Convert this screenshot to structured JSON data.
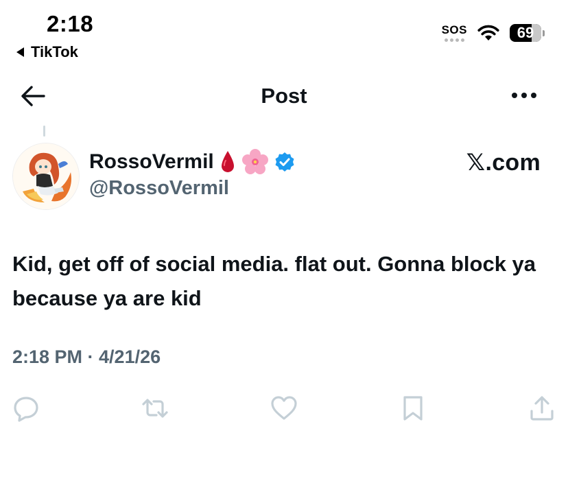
{
  "status_bar": {
    "time": "2:18",
    "back_app": "TikTok",
    "sos": "SOS",
    "battery": "69"
  },
  "header": {
    "title": "Post"
  },
  "post": {
    "display_name": "RossoVermil",
    "name_emojis": [
      "🩸",
      "🌸"
    ],
    "handle": "@RossoVermil",
    "source": "𝕏.com",
    "text": "Kid, get off of social media. flat out. Gonna block ya because ya are kid",
    "timestamp": "2:18 PM · 4/21/26"
  },
  "actions": [
    "reply-icon",
    "repost-icon",
    "like-icon",
    "bookmark-icon",
    "share-icon"
  ],
  "colors": {
    "text": "#0f1419",
    "secondary": "#536471",
    "action_icon": "#c4cfd6",
    "verified": "#1d9bf0"
  }
}
